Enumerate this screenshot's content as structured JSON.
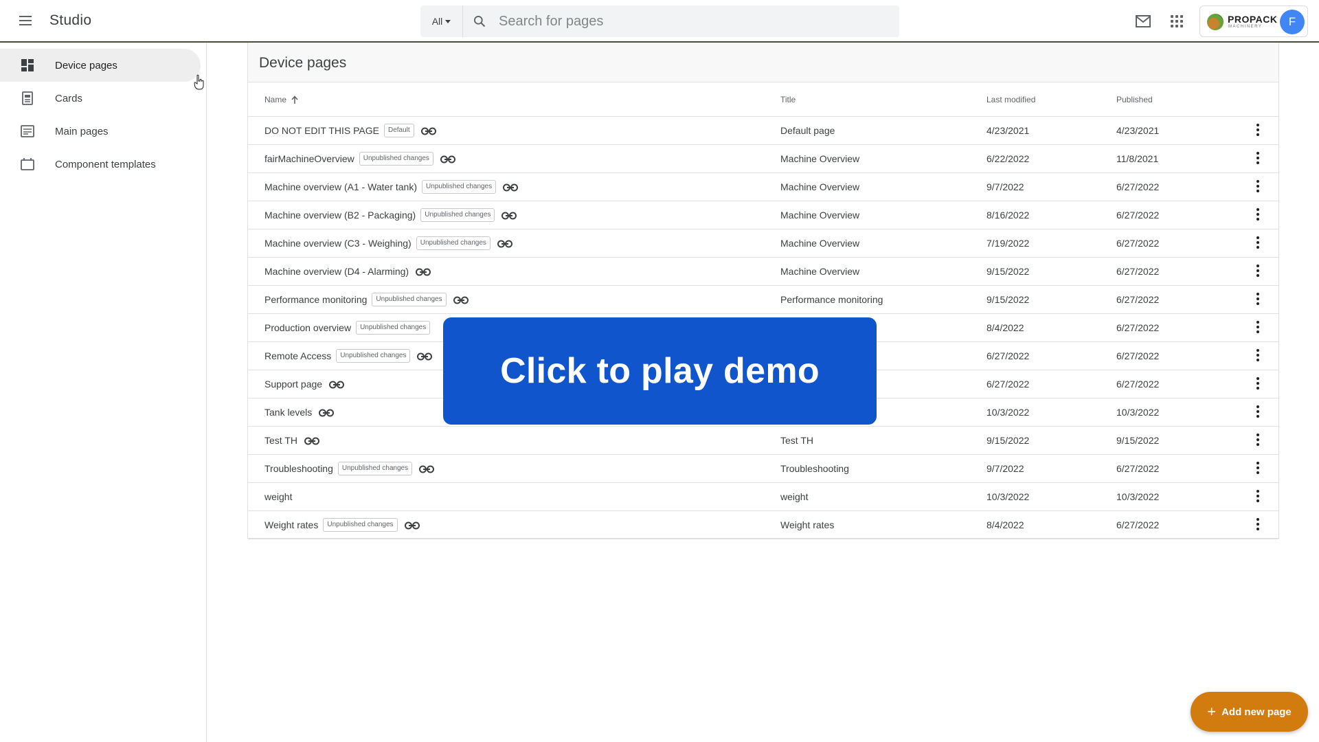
{
  "header": {
    "app_title": "Studio",
    "search_filter": "All",
    "search_placeholder": "Search for pages",
    "brand_name": "PROPACK",
    "brand_sub": "MACHINERY",
    "avatar_initial": "F"
  },
  "sidebar": {
    "items": [
      {
        "label": "Device pages",
        "icon": "dashboard-icon",
        "active": true
      },
      {
        "label": "Cards",
        "icon": "card-icon",
        "active": false
      },
      {
        "label": "Main pages",
        "icon": "page-icon",
        "active": false
      },
      {
        "label": "Component templates",
        "icon": "template-icon",
        "active": false
      }
    ]
  },
  "main": {
    "heading": "Device pages",
    "columns": {
      "name": "Name",
      "title": "Title",
      "modified": "Last modified",
      "published": "Published"
    },
    "rows": [
      {
        "name": "DO NOT EDIT THIS PAGE",
        "badge": "Default",
        "link": true,
        "title": "Default page",
        "modified": "4/23/2021",
        "published": "4/23/2021"
      },
      {
        "name": "fairMachineOverview",
        "badge": "Unpublished changes",
        "link": true,
        "title": "Machine Overview",
        "modified": "6/22/2022",
        "published": "11/8/2021"
      },
      {
        "name": "Machine overview (A1 - Water tank)",
        "badge": "Unpublished changes",
        "link": true,
        "title": "Machine Overview",
        "modified": "9/7/2022",
        "published": "6/27/2022"
      },
      {
        "name": "Machine overview (B2 - Packaging)",
        "badge": "Unpublished changes",
        "link": true,
        "title": "Machine Overview",
        "modified": "8/16/2022",
        "published": "6/27/2022"
      },
      {
        "name": "Machine overview (C3 - Weighing)",
        "badge": "Unpublished changes",
        "link": true,
        "title": "Machine Overview",
        "modified": "7/19/2022",
        "published": "6/27/2022"
      },
      {
        "name": "Machine overview (D4 - Alarming)",
        "badge": "",
        "link": true,
        "title": "Machine Overview",
        "modified": "9/15/2022",
        "published": "6/27/2022"
      },
      {
        "name": "Performance monitoring",
        "badge": "Unpublished changes",
        "link": true,
        "title": "Performance monitoring",
        "modified": "9/15/2022",
        "published": "6/27/2022"
      },
      {
        "name": "Production overview",
        "badge": "Unpublished changes",
        "link": false,
        "title": "",
        "modified": "8/4/2022",
        "published": "6/27/2022"
      },
      {
        "name": "Remote Access",
        "badge": "Unpublished changes",
        "link": true,
        "title": "",
        "modified": "6/27/2022",
        "published": "6/27/2022"
      },
      {
        "name": "Support page",
        "badge": "",
        "link": true,
        "title": "",
        "modified": "6/27/2022",
        "published": "6/27/2022"
      },
      {
        "name": "Tank levels",
        "badge": "",
        "link": true,
        "title": "",
        "modified": "10/3/2022",
        "published": "10/3/2022"
      },
      {
        "name": "Test TH",
        "badge": "",
        "link": true,
        "title": "Test TH",
        "modified": "9/15/2022",
        "published": "9/15/2022"
      },
      {
        "name": "Troubleshooting",
        "badge": "Unpublished changes",
        "link": true,
        "title": "Troubleshooting",
        "modified": "9/7/2022",
        "published": "6/27/2022"
      },
      {
        "name": "weight",
        "badge": "",
        "link": false,
        "title": "weight",
        "modified": "10/3/2022",
        "published": "10/3/2022"
      },
      {
        "name": "Weight rates",
        "badge": "Unpublished changes",
        "link": true,
        "title": "Weight rates",
        "modified": "8/4/2022",
        "published": "6/27/2022"
      }
    ]
  },
  "overlay": {
    "label": "Click to play demo"
  },
  "fab": {
    "label": "Add new page"
  },
  "colors": {
    "accent": "#d27b0f",
    "overlay": "#1155cc",
    "avatar": "#4285f4"
  }
}
